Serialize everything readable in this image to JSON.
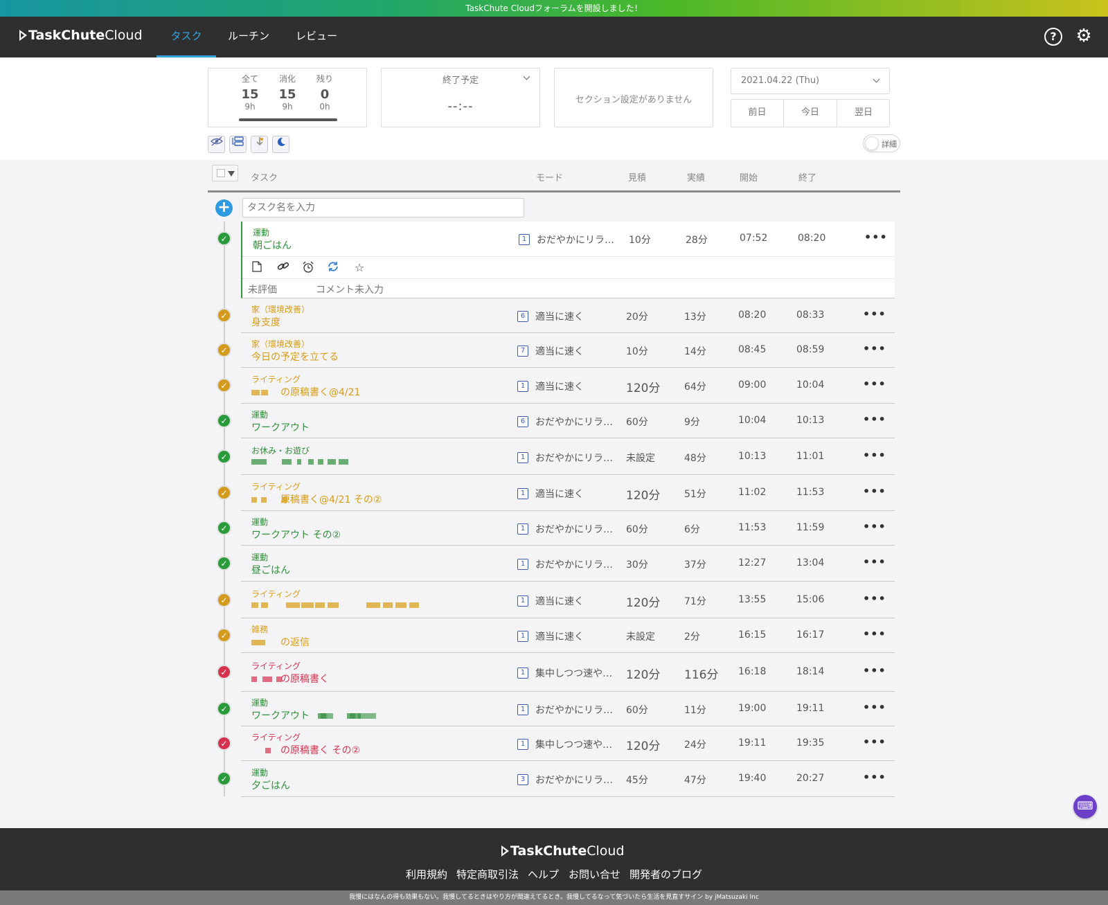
{
  "banner": {
    "text": "TaskChute Cloudフォーラムを開設しました！"
  },
  "header": {
    "logo": {
      "bold": "TaskChute",
      "light": "Cloud"
    },
    "nav": [
      {
        "label": "タスク",
        "active": true
      },
      {
        "label": "ルーチン"
      },
      {
        "label": "レビュー"
      }
    ],
    "help_icon": "?",
    "settings_icon": "⚙"
  },
  "summary": {
    "cols": [
      {
        "label": "全て",
        "count": "15",
        "hours": "9h"
      },
      {
        "label": "消化",
        "count": "15",
        "hours": "9h"
      },
      {
        "label": "残り",
        "count": "0",
        "hours": "0h"
      }
    ],
    "progress_fraction": 1.0
  },
  "end_plan": {
    "title": "終了予定",
    "value": "--:--"
  },
  "section": {
    "text": "セクション設定がありません"
  },
  "date": {
    "value": "2021.04.22 (Thu)",
    "prev": "前日",
    "today": "今日",
    "next": "翌日"
  },
  "detail_toggle": {
    "label": "詳細"
  },
  "columns": {
    "task": "タスク",
    "mode": "モード",
    "estimate": "見積",
    "actual": "実績",
    "start": "開始",
    "end": "終了"
  },
  "input": {
    "placeholder": "タスク名を入力"
  },
  "selected_detail": {
    "rating": "未評価",
    "comment": "コメント未入力"
  },
  "tasks": [
    {
      "category": "運動",
      "name": "朝ごはん",
      "mode_num": "1",
      "mode": "おだやかにリラ…",
      "estimate": "10分",
      "actual": "28分",
      "start": "07:52",
      "end": "08:20",
      "color": "green"
    },
    {
      "category": "家（環境改善）",
      "name": "身支度",
      "mode_num": "6",
      "mode": "適当に速く",
      "estimate": "20分",
      "actual": "13分",
      "start": "08:20",
      "end": "08:33",
      "color": "orange"
    },
    {
      "category": "家（環境改善）",
      "name": "今日の予定を立てる",
      "mode_num": "7",
      "mode": "適当に速く",
      "estimate": "10分",
      "actual": "14分",
      "start": "08:45",
      "end": "08:59",
      "color": "orange"
    },
    {
      "category": "ライティング",
      "name": "の原稿書く@4/21",
      "mode_num": "1",
      "mode": "適当に速く",
      "estimate": "120分",
      "actual": "64分",
      "start": "09:00",
      "end": "10:04",
      "color": "orange"
    },
    {
      "category": "運動",
      "name": "ワークアウト",
      "mode_num": "6",
      "mode": "おだやかにリラ…",
      "estimate": "60分",
      "actual": "9分",
      "start": "10:04",
      "end": "10:13",
      "color": "green"
    },
    {
      "category": "お休み・お遊び",
      "name": "",
      "mode_num": "1",
      "mode": "おだやかにリラ…",
      "estimate": "未設定",
      "actual": "48分",
      "start": "10:13",
      "end": "11:01",
      "color": "green"
    },
    {
      "category": "ライティング",
      "name": "原稿書く@4/21 その②",
      "mode_num": "1",
      "mode": "適当に速く",
      "estimate": "120分",
      "actual": "51分",
      "start": "11:02",
      "end": "11:53",
      "color": "orange"
    },
    {
      "category": "運動",
      "name": "ワークアウト その②",
      "mode_num": "1",
      "mode": "おだやかにリラ…",
      "estimate": "60分",
      "actual": "6分",
      "start": "11:53",
      "end": "11:59",
      "color": "green"
    },
    {
      "category": "運動",
      "name": "昼ごはん",
      "mode_num": "1",
      "mode": "おだやかにリラ…",
      "estimate": "30分",
      "actual": "37分",
      "start": "12:27",
      "end": "13:04",
      "color": "green"
    },
    {
      "category": "ライティング",
      "name": "",
      "mode_num": "1",
      "mode": "適当に速く",
      "estimate": "120分",
      "actual": "71分",
      "start": "13:55",
      "end": "15:06",
      "color": "orange"
    },
    {
      "category": "雑務",
      "name": "の返信",
      "mode_num": "1",
      "mode": "適当に速く",
      "estimate": "未設定",
      "actual": "2分",
      "start": "16:15",
      "end": "16:17",
      "color": "orange"
    },
    {
      "category": "ライティング",
      "name": "の原稿書く",
      "mode_num": "1",
      "mode": "集中しつつ速や…",
      "estimate": "120分",
      "actual": "116分",
      "start": "16:18",
      "end": "18:14",
      "color": "red"
    },
    {
      "category": "運動",
      "name": "ワークアウト",
      "mode_num": "1",
      "mode": "おだやかにリラ…",
      "estimate": "60分",
      "actual": "11分",
      "start": "19:00",
      "end": "19:11",
      "color": "green"
    },
    {
      "category": "ライティング",
      "name": "の原稿書く その②",
      "mode_num": "1",
      "mode": "集中しつつ速や…",
      "estimate": "120分",
      "actual": "24分",
      "start": "19:11",
      "end": "19:35",
      "color": "red"
    },
    {
      "category": "運動",
      "name": "夕ごはん",
      "mode_num": "3",
      "mode": "おだやかにリラ…",
      "estimate": "45分",
      "actual": "47分",
      "start": "19:40",
      "end": "20:27",
      "color": "green"
    }
  ],
  "footer": {
    "logo": {
      "bold": "TaskChute",
      "light": "Cloud"
    },
    "links": [
      "利用規約",
      "特定商取引法",
      "ヘルプ",
      "お問い合せ",
      "開発者のブログ"
    ],
    "tagline": "我慢にはなんの得も効果もない。我慢してるときはやり方が間違えてるとき。我慢してるなって気づいたら生活を見直すサイン by jMatsuzaki Inc"
  },
  "colors": {
    "green": "#2e8f3a",
    "orange": "#d89b12",
    "red": "#d6324e",
    "accent": "#34a3e3"
  }
}
